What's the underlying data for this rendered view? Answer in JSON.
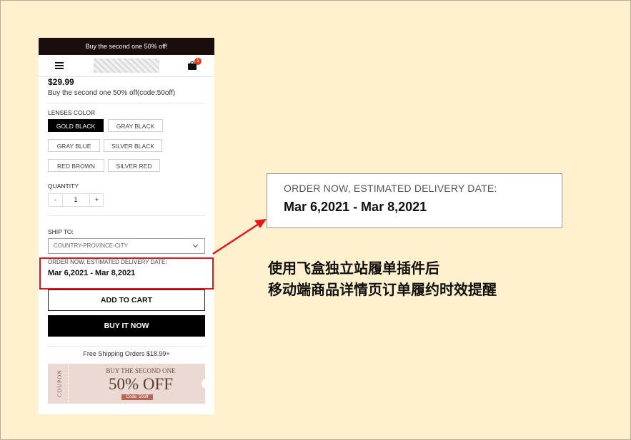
{
  "announcement": "Buy the second one 50% off!",
  "header": {
    "cart_count": "1"
  },
  "product": {
    "price": "$29.99",
    "promo": "Buy the second one 50% off(code:50off)"
  },
  "lenses": {
    "label": "LENSES COLOR",
    "options": [
      "GOLD BLACK",
      "GRAY BLACK",
      "GRAY BLUE",
      "SILVER BLACK",
      "RED BROWN",
      "SILVER RED"
    ],
    "selected": "GOLD BLACK"
  },
  "quantity": {
    "label": "QUANTITY",
    "minus": "-",
    "value": "1",
    "plus": "+"
  },
  "ship": {
    "label": "SHIP TO:",
    "placeholder": "COUNTRY-PROVINCE-CITY"
  },
  "delivery": {
    "label": "ORDER NOW, ESTIMATED DELIVERY DATE:",
    "dates": "Mar 6,2021 - Mar 8,2021"
  },
  "buttons": {
    "add_to_cart": "ADD TO CART",
    "buy_now": "BUY IT NOW"
  },
  "shipping_note": "Free Shipping Orders $18.99+",
  "coupon": {
    "side": "COUPON",
    "line1": "BUY THE SECOND ONE",
    "line2": "50% OFF",
    "code": "Code: 50off"
  },
  "callout": {
    "label": "ORDER NOW, ESTIMATED DELIVERY DATE:",
    "dates": "Mar 6,2021 - Mar 8,2021"
  },
  "caption": {
    "line1": "使用飞盒独立站履单插件后",
    "line2": "移动端商品详情页订单履约时效提醒"
  },
  "colors": {
    "highlight": "#e8141c",
    "background": "#fff1cd",
    "announce_bg": "#1a0e0c"
  },
  "icons": [
    "menu-icon",
    "cart-icon",
    "chevron-down-icon"
  ]
}
